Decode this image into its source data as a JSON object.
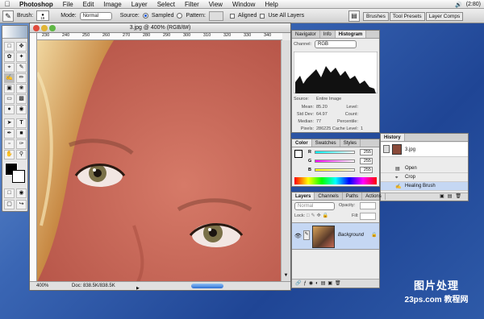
{
  "menubar": {
    "app": "Photoshop",
    "items": [
      "File",
      "Edit",
      "Image",
      "Layer",
      "Select",
      "Filter",
      "View",
      "Window",
      "Help"
    ],
    "battery": "(2:80)"
  },
  "options": {
    "brush_label": "Brush:",
    "brush_size": "19",
    "mode_label": "Mode:",
    "mode_value": "Normal",
    "source_label": "Source:",
    "sampled": "Sampled",
    "pattern": "Pattern:",
    "aligned": "Aligned",
    "use_all_layers": "Use All Layers",
    "tabs": [
      "Brushes",
      "Tool Presets",
      "Layer Comps"
    ]
  },
  "document": {
    "title": "3.jpg @ 400% (RGB/8#)",
    "zoom": "400%",
    "doc_info": "Doc: 838.5K/838.5K",
    "ruler_ticks": [
      "230",
      "240",
      "250",
      "260",
      "270",
      "280",
      "290",
      "300",
      "310",
      "320",
      "330",
      "340"
    ]
  },
  "navigator": {
    "tabs": [
      "Navigator",
      "Info",
      "Histogram"
    ],
    "channel_label": "Channel:",
    "channel_value": "RGB",
    "source_label": "Source:",
    "source_value": "Entire Image",
    "stats_left": [
      {
        "k": "Mean:",
        "v": "85.20"
      },
      {
        "k": "Std Dev:",
        "v": "64.97"
      },
      {
        "k": "Median:",
        "v": "77"
      },
      {
        "k": "Pixels:",
        "v": "286225"
      }
    ],
    "stats_right": [
      {
        "k": "Level:",
        "v": ""
      },
      {
        "k": "Count:",
        "v": ""
      },
      {
        "k": "Percentile:",
        "v": ""
      },
      {
        "k": "Cache Level:",
        "v": "1"
      }
    ]
  },
  "color": {
    "tabs": [
      "Color",
      "Swatches",
      "Styles"
    ],
    "channels": [
      {
        "label": "R",
        "value": "255"
      },
      {
        "label": "G",
        "value": "255"
      },
      {
        "label": "B",
        "value": "255"
      }
    ]
  },
  "history": {
    "tabs": [
      "History"
    ],
    "snapshot": "3.jpg",
    "items": [
      "Open",
      "Crop",
      "Healing Brush"
    ]
  },
  "layers": {
    "tabs": [
      "Layers",
      "Channels",
      "Paths",
      "Actions"
    ],
    "mode": "Normal",
    "opacity_label": "Opacity:",
    "lock_label": "Lock:",
    "fill_label": "Fill:",
    "layer_name": "Background"
  },
  "watermark": {
    "line1": "图片处理",
    "line2": "23ps.com 教程网"
  }
}
